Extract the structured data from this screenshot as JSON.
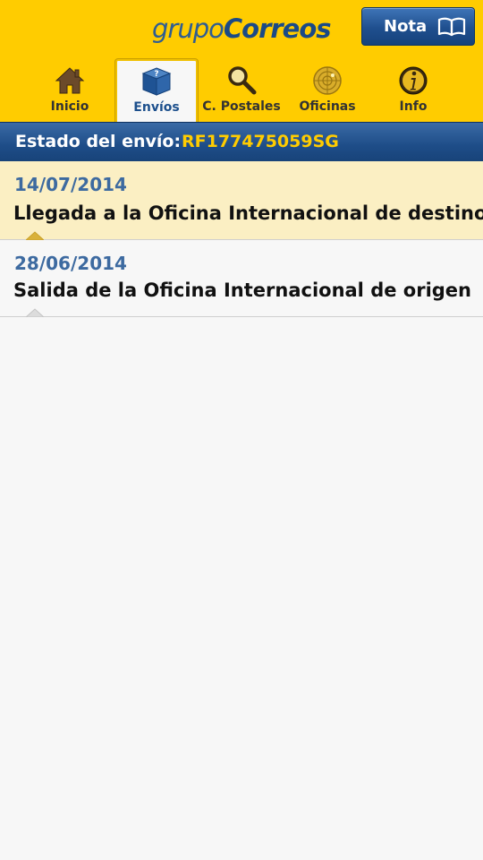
{
  "header": {
    "logo": {
      "part1": "grupo",
      "part2": "Correos"
    },
    "nota_button": {
      "label": "Nota",
      "icon": "book-icon"
    }
  },
  "tabs": [
    {
      "label": "Inicio",
      "icon": "home-icon",
      "active": false
    },
    {
      "label": "Envíos",
      "icon": "package-icon",
      "active": true
    },
    {
      "label": "C. Postales",
      "icon": "magnifier-icon",
      "active": false
    },
    {
      "label": "Oficinas",
      "icon": "radar-icon",
      "active": false
    },
    {
      "label": "Info",
      "icon": "info-icon",
      "active": false
    }
  ],
  "status": {
    "title": "Estado del envío:",
    "tracking_code": "RF177475059SG"
  },
  "events": [
    {
      "date": "14/07/2014",
      "description": "Llegada a la Oficina Internacional de destino",
      "highlighted": true
    },
    {
      "date": "28/06/2014",
      "description": "Salida de la Oficina Internacional de origen",
      "highlighted": false
    }
  ],
  "colors": {
    "brand_yellow": "#ffcc00",
    "brand_blue": "#1e4d88",
    "highlight_row": "#fbefc3",
    "date_blue": "#3d6aa0"
  }
}
